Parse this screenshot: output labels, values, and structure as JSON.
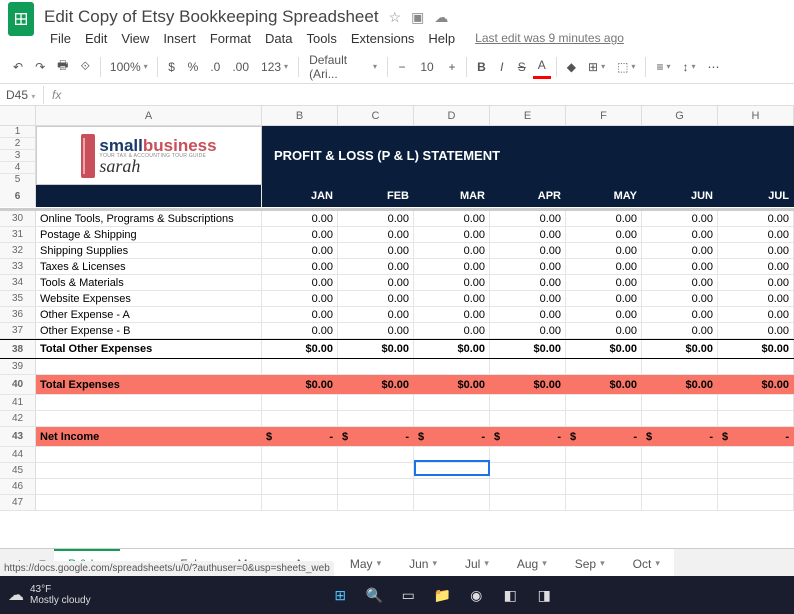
{
  "doc_title": "Edit Copy of Etsy Bookkeeping Spreadsheet",
  "menus": [
    "File",
    "Edit",
    "View",
    "Insert",
    "Format",
    "Data",
    "Tools",
    "Extensions",
    "Help"
  ],
  "last_edit": "Last edit was 9 minutes ago",
  "toolbar": {
    "zoom": "100%",
    "font": "Default (Ari...",
    "fontsize": "10",
    "more": "123"
  },
  "namebox": "D45",
  "header_title": "PROFIT & LOSS (P & L) STATEMENT",
  "logo": {
    "line1a": "small",
    "line1b": "business",
    "sub": "YOUR TAX & ACCOUNTING TOUR GUIDE",
    "name": "sarah"
  },
  "col_letters": [
    "A",
    "B",
    "C",
    "D",
    "E",
    "F",
    "G",
    "H"
  ],
  "months": [
    "JAN",
    "FEB",
    "MAR",
    "APR",
    "MAY",
    "JUN",
    "JUL"
  ],
  "frozen_rows": [
    "1",
    "2",
    "3",
    "4",
    "5",
    "6"
  ],
  "expense_rows": [
    {
      "n": "30",
      "label": "Online Tools, Programs & Subscriptions",
      "v": "0.00"
    },
    {
      "n": "31",
      "label": "Postage & Shipping",
      "v": "0.00"
    },
    {
      "n": "32",
      "label": "Shipping Supplies",
      "v": "0.00"
    },
    {
      "n": "33",
      "label": "Taxes & Licenses",
      "v": "0.00"
    },
    {
      "n": "34",
      "label": "Tools & Materials",
      "v": "0.00"
    },
    {
      "n": "35",
      "label": "Website Expenses",
      "v": "0.00"
    },
    {
      "n": "36",
      "label": "Other Expense - A",
      "v": "0.00"
    },
    {
      "n": "37",
      "label": "Other Expense - B",
      "v": "0.00"
    }
  ],
  "total_other": {
    "n": "38",
    "label": "Total Other Expenses",
    "v": "$0.00"
  },
  "total_exp": {
    "n": "40",
    "label": "Total Expenses",
    "v": "$0.00"
  },
  "net_income": {
    "n": "43",
    "label": "Net Income",
    "d": "$",
    "dash": "-"
  },
  "empty_rows": [
    "39",
    "41",
    "42",
    "44",
    "45",
    "46",
    "47"
  ],
  "sheet_tabs": [
    "P & L",
    "Feb",
    "Mar",
    "Apr",
    "May",
    "Jun",
    "Jul",
    "Aug",
    "Sep",
    "Oct"
  ],
  "status_url": "https://docs.google.com/spreadsheets/u/0/?authuser=0&usp=sheets_web",
  "weather": {
    "temp": "43°F",
    "cond": "Mostly cloudy"
  }
}
